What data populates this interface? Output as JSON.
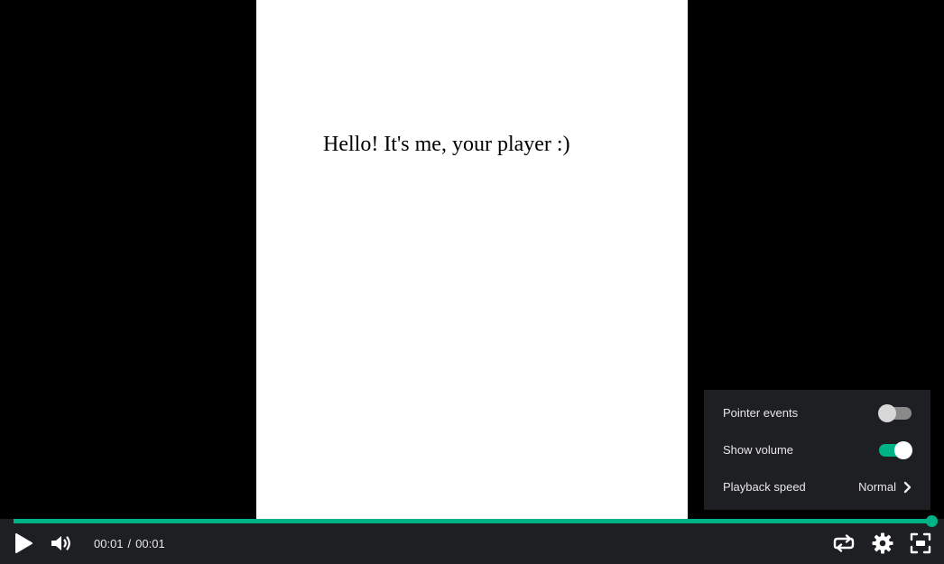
{
  "stage": {
    "text": "Hello! It's me, your player :)"
  },
  "settings_menu": {
    "pointer_events": {
      "label": "Pointer events",
      "enabled": false
    },
    "show_volume": {
      "label": "Show volume",
      "enabled": true
    },
    "playback_speed": {
      "label": "Playback speed",
      "value": "Normal"
    }
  },
  "controls": {
    "current_time": "00:01",
    "separator": "/",
    "duration": "00:01",
    "progress_fraction": 1.0
  },
  "colors": {
    "accent": "#00b386",
    "bar_background": "#1e1f23",
    "text": "#e8e8e8"
  },
  "icons": {
    "play": "play-icon",
    "volume": "volume-icon",
    "loop": "loop-icon",
    "settings": "gear-icon",
    "fullscreen": "fullscreen-icon",
    "submenu": "chevron-right-icon"
  }
}
